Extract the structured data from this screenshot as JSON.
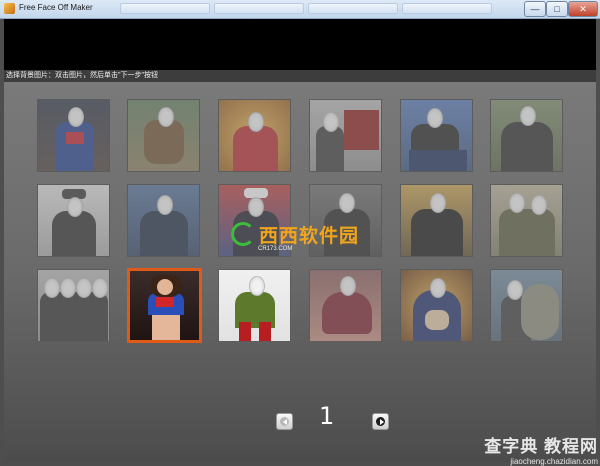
{
  "window": {
    "title": "Free Face Off Maker",
    "background_tabs": [
      "",
      "",
      "",
      ""
    ],
    "minimize_label": "—",
    "maximize_label": "□",
    "close_label": "✕"
  },
  "instruction": "选择背景图片：双击图片，然后单击\"下一步\"按钮",
  "grid": {
    "selected_index": 13,
    "items": [
      {
        "name": "superman"
      },
      {
        "name": "fisherman"
      },
      {
        "name": "saint-portrait"
      },
      {
        "name": "walking-dead-poster"
      },
      {
        "name": "president-elect"
      },
      {
        "name": "samurai-kimono"
      },
      {
        "name": "police-officer-white"
      },
      {
        "name": "police-officer-dark"
      },
      {
        "name": "firefighter-officer"
      },
      {
        "name": "man-in-suit-watermark"
      },
      {
        "name": "oscar-tuxedo"
      },
      {
        "name": "soldier-group"
      },
      {
        "name": "men-in-suits-group"
      },
      {
        "name": "superwoman"
      },
      {
        "name": "superhero-woman"
      },
      {
        "name": "sitting-woman"
      },
      {
        "name": "madonna-painting"
      },
      {
        "name": "fisherman-big-fish"
      }
    ]
  },
  "pagination": {
    "current_page": "1"
  },
  "watermark": {
    "logo_text": "西西软件园",
    "logo_sub": "CR173.COM",
    "corner_big": "查字典 教程网",
    "corner_small": "jiaocheng.chazidian.com"
  },
  "colors": {
    "selected_border": "#e05a18",
    "background": "#6a6a6a"
  }
}
